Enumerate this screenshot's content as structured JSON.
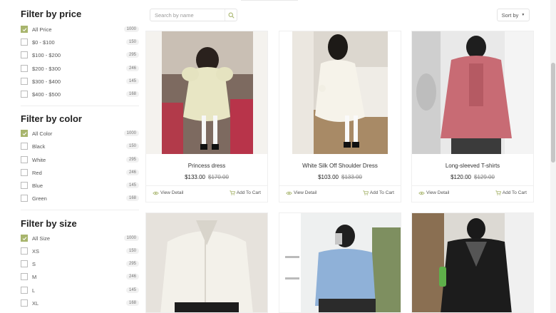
{
  "filters": {
    "price": {
      "title": "Filter by price",
      "options": [
        {
          "label": "All Price",
          "count": "1000",
          "checked": true
        },
        {
          "label": "$0 - $100",
          "count": "150",
          "checked": false
        },
        {
          "label": "$100 - $200",
          "count": "295",
          "checked": false
        },
        {
          "label": "$200 - $300",
          "count": "246",
          "checked": false
        },
        {
          "label": "$300 - $400",
          "count": "145",
          "checked": false
        },
        {
          "label": "$400 - $500",
          "count": "168",
          "checked": false
        }
      ]
    },
    "color": {
      "title": "Filter by color",
      "options": [
        {
          "label": "All Color",
          "count": "1000",
          "checked": true
        },
        {
          "label": "Black",
          "count": "150",
          "checked": false
        },
        {
          "label": "White",
          "count": "295",
          "checked": false
        },
        {
          "label": "Red",
          "count": "246",
          "checked": false
        },
        {
          "label": "Blue",
          "count": "145",
          "checked": false
        },
        {
          "label": "Green",
          "count": "168",
          "checked": false
        }
      ]
    },
    "size": {
      "title": "Filter by size",
      "options": [
        {
          "label": "All Size",
          "count": "1000",
          "checked": true
        },
        {
          "label": "XS",
          "count": "150",
          "checked": false
        },
        {
          "label": "S",
          "count": "295",
          "checked": false
        },
        {
          "label": "M",
          "count": "246",
          "checked": false
        },
        {
          "label": "L",
          "count": "145",
          "checked": false
        },
        {
          "label": "XL",
          "count": "168",
          "checked": false
        }
      ]
    }
  },
  "toolbar": {
    "search_placeholder": "Search by name",
    "sort_label": "Sort by"
  },
  "products": [
    {
      "name": "Princess dress",
      "price": "$133.00",
      "old_price": "$170.00",
      "view_label": "View Detail",
      "cart_label": "Add To Cart"
    },
    {
      "name": "White Silk Off Shoulder Dress",
      "price": "$103.00",
      "old_price": "$133.00",
      "view_label": "View Detail",
      "cart_label": "Add To Cart"
    },
    {
      "name": "Long-sleeved T-shirts",
      "price": "$120.00",
      "old_price": "$129.00",
      "view_label": "View Detail",
      "cart_label": "Add To Cart"
    }
  ],
  "colors": {
    "accent": "#a8b56d",
    "text": "#333333",
    "muted": "#888888"
  },
  "icons": {
    "search": "search-icon",
    "eye": "eye-icon",
    "cart": "cart-icon",
    "check": "check-icon",
    "caret": "caret-down-icon"
  }
}
